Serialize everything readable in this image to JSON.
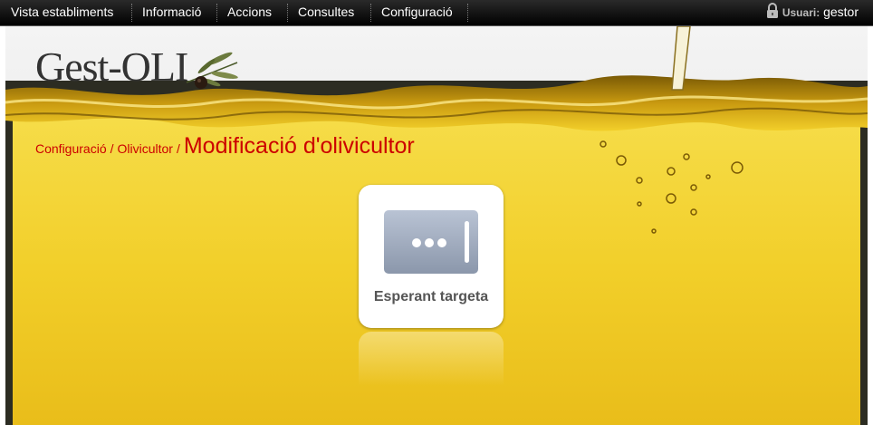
{
  "menu": {
    "items": [
      {
        "label": "Vista establiments"
      },
      {
        "label": "Informació"
      },
      {
        "label": "Accions"
      },
      {
        "label": "Consultes"
      },
      {
        "label": "Configuració"
      }
    ]
  },
  "user": {
    "label": "Usuari:",
    "name": "gestor"
  },
  "logo": {
    "text": "Gest-OLI"
  },
  "breadcrumb": {
    "items": [
      "Configuració",
      "Olivicultor"
    ],
    "separator": "/",
    "current": "Modificació d'olivicultor"
  },
  "card_widget": {
    "status": "Esperant targeta"
  },
  "colors": {
    "oil": "#f3cf2c",
    "oil_dark": "#d9a80c",
    "accent": "#cc0000",
    "menubar": "#000000"
  }
}
